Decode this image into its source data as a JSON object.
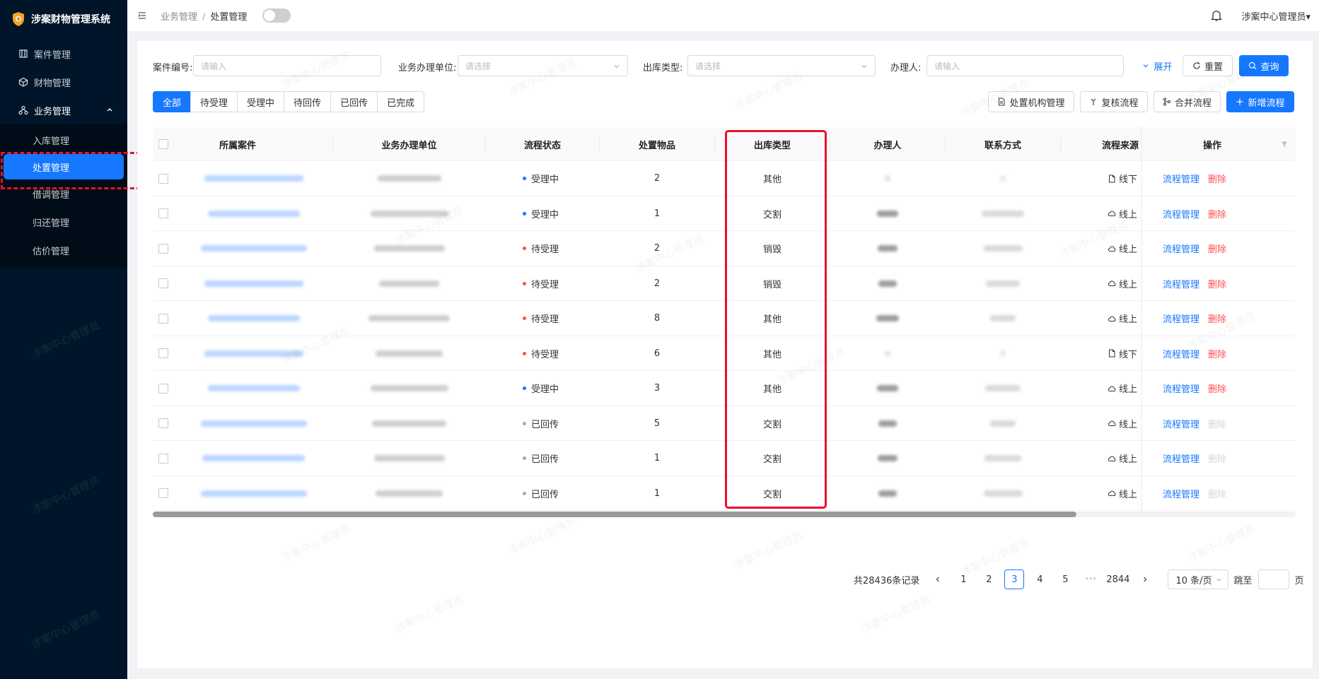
{
  "app": {
    "title": "涉案财物管理系统"
  },
  "sidebar": {
    "items": [
      {
        "label": "案件管理",
        "icon": "building-icon"
      },
      {
        "label": "财物管理",
        "icon": "cube-icon"
      }
    ],
    "group": {
      "label": "业务管理",
      "icon": "cluster-icon",
      "children": [
        {
          "label": "入库管理"
        },
        {
          "label": "处置管理",
          "active": true
        },
        {
          "label": "借调管理"
        },
        {
          "label": "归还管理"
        },
        {
          "label": "估价管理"
        }
      ]
    }
  },
  "header": {
    "breadcrumb": [
      "业务管理",
      "处置管理"
    ],
    "sep": "/",
    "user": "涉案中心管理员▾"
  },
  "filters": {
    "case_no": {
      "label": "案件编号:",
      "placeholder": "请输入"
    },
    "unit": {
      "label": "业务办理单位:",
      "placeholder": "请选择"
    },
    "out_type": {
      "label": "出库类型:",
      "placeholder": "请选择"
    },
    "handler": {
      "label": "办理人:",
      "placeholder": "请输入"
    },
    "expand": "展开",
    "reset": "重置",
    "query": "查询"
  },
  "tabs": [
    "全部",
    "待受理",
    "受理中",
    "待回传",
    "已回传",
    "已完成"
  ],
  "toolbar": {
    "org_manage": "处置机构管理",
    "review_flow": "复核流程",
    "merge_flow": "合并流程",
    "new_flow": "新增流程"
  },
  "table": {
    "columns": [
      "所属案件",
      "业务办理单位",
      "流程状态",
      "处置物品",
      "出库类型",
      "办理人",
      "联系方式",
      "流程来源",
      "操作"
    ],
    "rows": [
      {
        "status": "受理中",
        "status_color": "#1677ff",
        "items": "2",
        "out_type": "其他",
        "source": "线下",
        "source_icon": "file-icon",
        "del_enabled": true
      },
      {
        "status": "受理中",
        "status_color": "#1677ff",
        "items": "1",
        "out_type": "交割",
        "source": "线上",
        "source_icon": "cloud-icon",
        "del_enabled": true
      },
      {
        "status": "待受理",
        "status_color": "#ff4d4f",
        "items": "2",
        "out_type": "销毁",
        "source": "线上",
        "source_icon": "cloud-icon",
        "del_enabled": true
      },
      {
        "status": "待受理",
        "status_color": "#ff4d4f",
        "items": "2",
        "out_type": "销毁",
        "source": "线上",
        "source_icon": "cloud-icon",
        "del_enabled": true
      },
      {
        "status": "待受理",
        "status_color": "#ff4d4f",
        "items": "8",
        "out_type": "其他",
        "source": "线上",
        "source_icon": "cloud-icon",
        "del_enabled": true
      },
      {
        "status": "待受理",
        "status_color": "#ff4d4f",
        "items": "6",
        "out_type": "其他",
        "source": "线下",
        "source_icon": "file-icon",
        "del_enabled": true
      },
      {
        "status": "受理中",
        "status_color": "#1677ff",
        "items": "3",
        "out_type": "其他",
        "source": "线上",
        "source_icon": "cloud-icon",
        "del_enabled": true
      },
      {
        "status": "已回传",
        "status_color": "#aaaaaa",
        "items": "5",
        "out_type": "交割",
        "source": "线上",
        "source_icon": "cloud-icon",
        "del_enabled": false
      },
      {
        "status": "已回传",
        "status_color": "#aaaaaa",
        "items": "1",
        "out_type": "交割",
        "source": "线上",
        "source_icon": "cloud-icon",
        "del_enabled": false
      },
      {
        "status": "已回传",
        "status_color": "#aaaaaa",
        "items": "1",
        "out_type": "交割",
        "source": "线上",
        "source_icon": "cloud-icon",
        "del_enabled": false
      }
    ],
    "op_manage": "流程管理",
    "op_delete": "删除"
  },
  "pagination": {
    "total": "共28436条记录",
    "pages": [
      "1",
      "2",
      "3",
      "4",
      "5"
    ],
    "current": "3",
    "ellipsis": "•••",
    "last": "2844",
    "page_size": "10 条/页",
    "jump_label": "跳至",
    "jump_suffix": "页"
  },
  "watermark": "涉案中心管理员",
  "colors": {
    "primary": "#1677ff",
    "sidebar": "#001529",
    "danger": "#ff4d4f",
    "highlight": "#e8112d"
  }
}
